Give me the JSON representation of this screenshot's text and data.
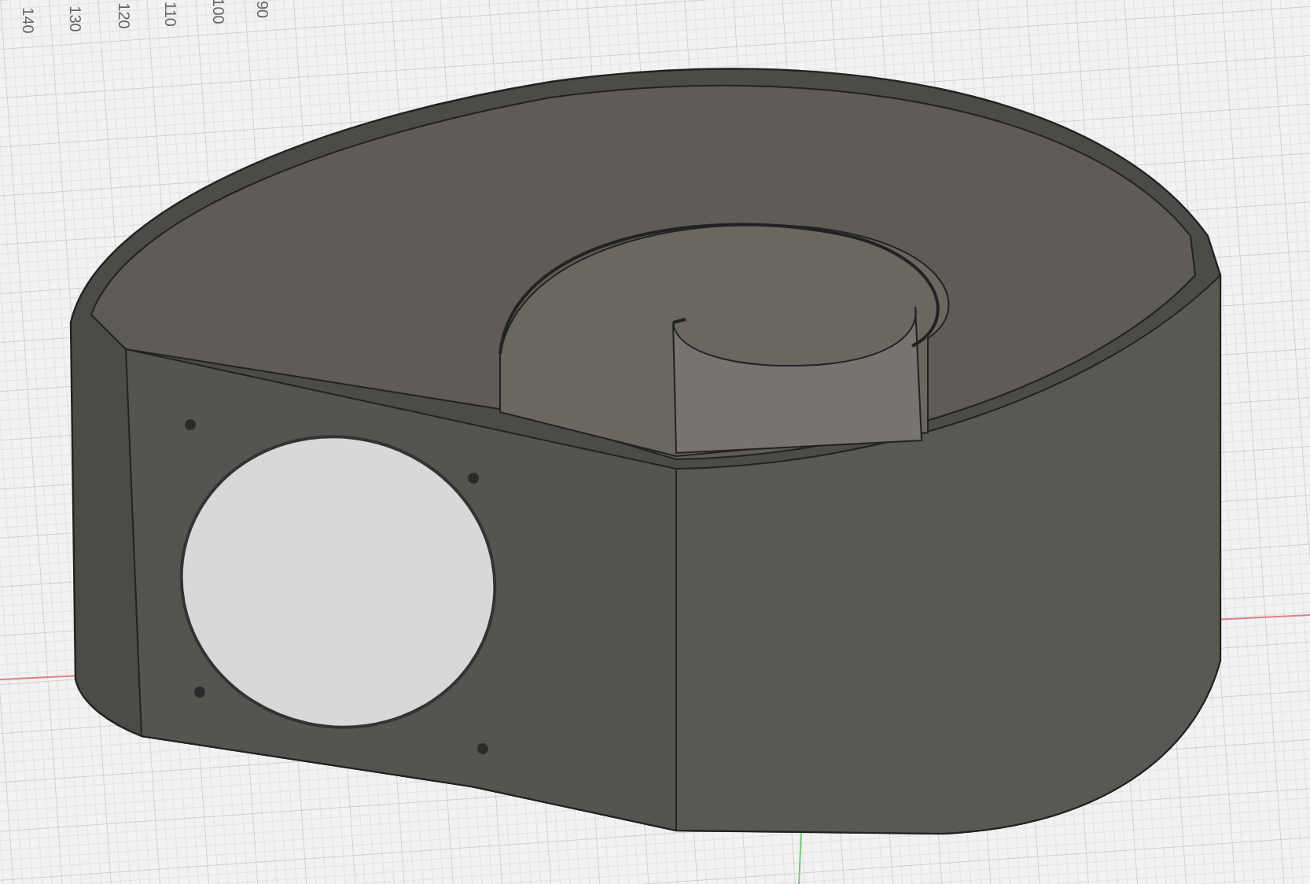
{
  "ruler_labels": [
    "140",
    "130",
    "120",
    "110",
    "100",
    "90"
  ]
}
